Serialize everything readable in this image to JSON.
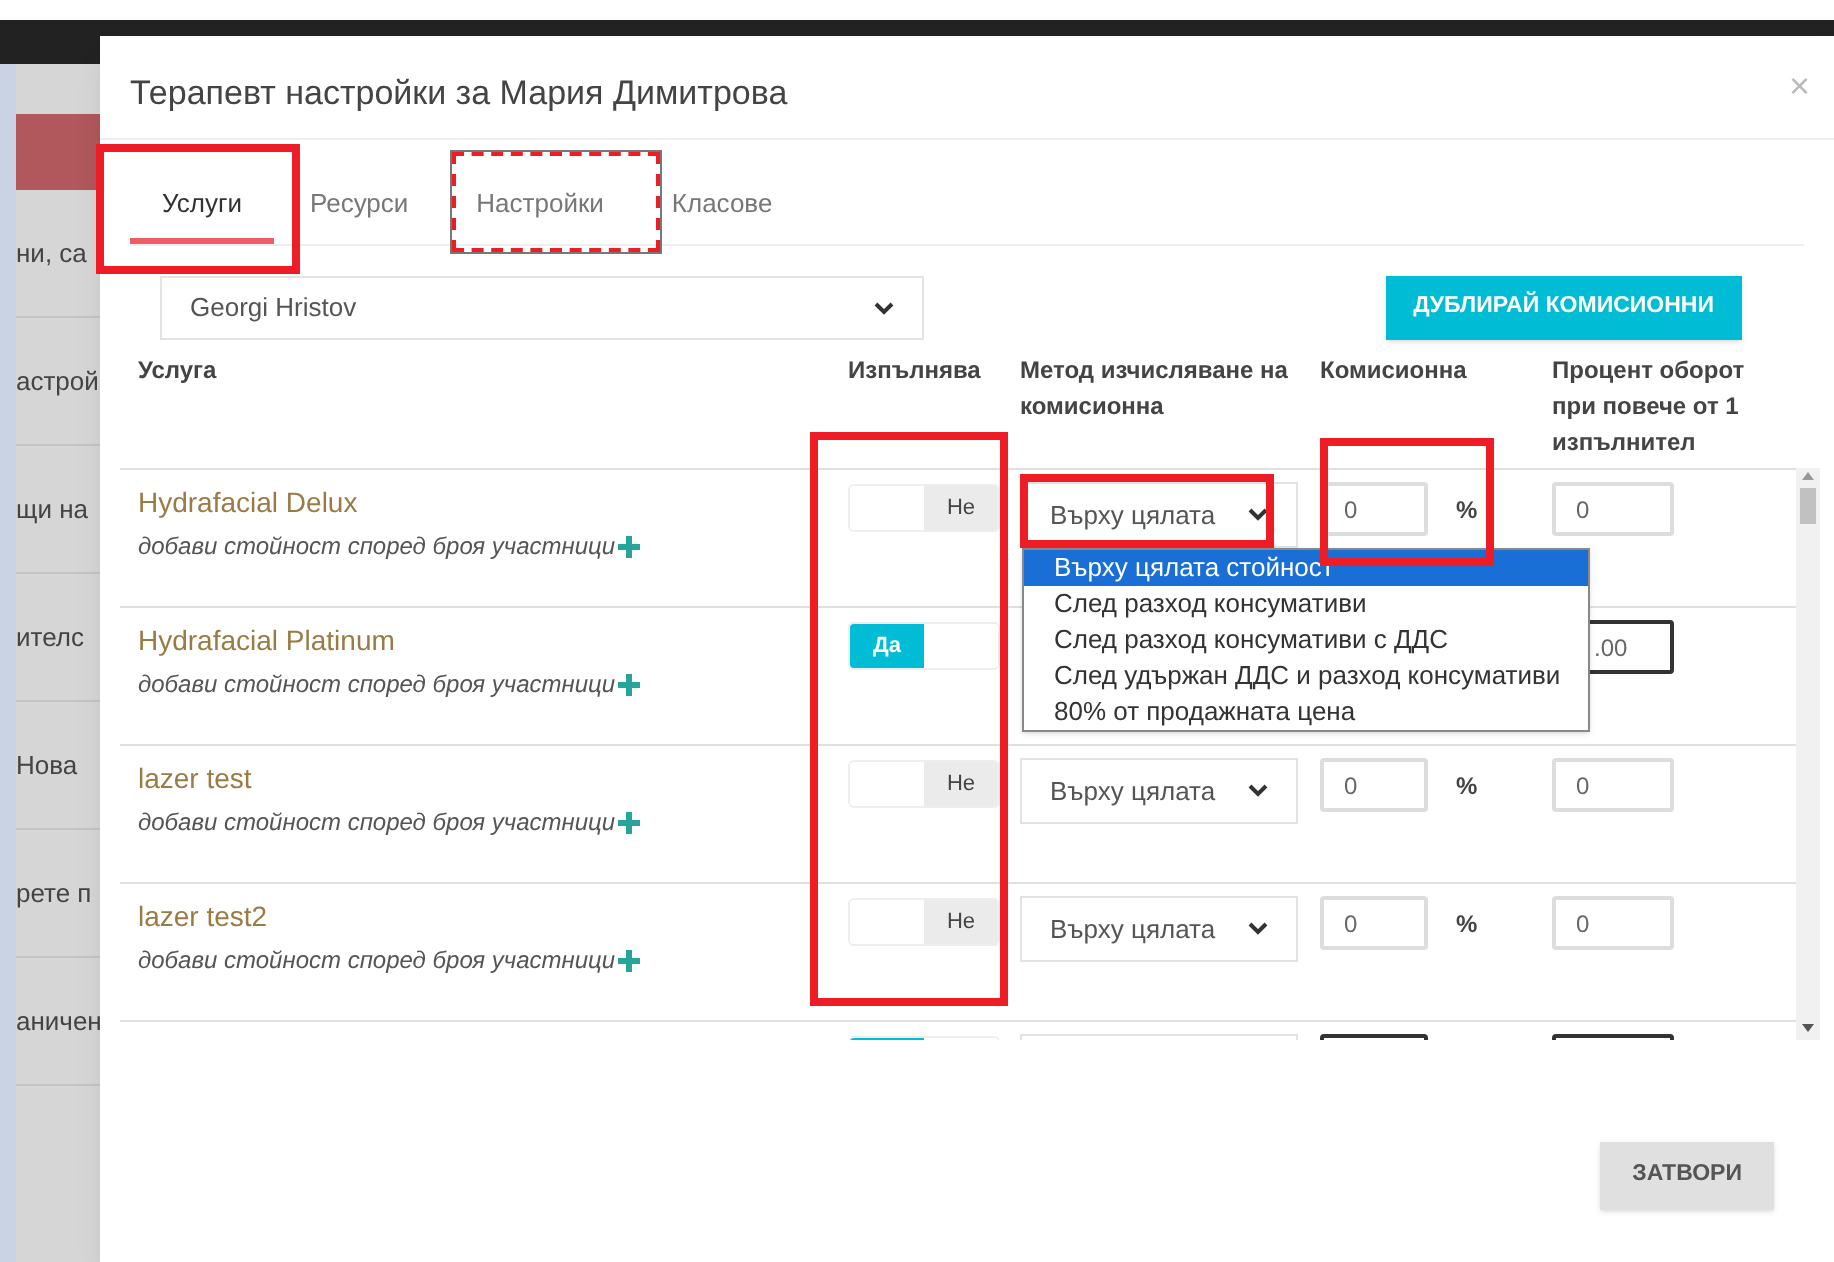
{
  "background_menu": [
    "ни, са",
    "астрой",
    "щи на",
    "ителс",
    "Нова",
    "рете п",
    "аничен"
  ],
  "dialog": {
    "title": "Терапевт настройки за Мария Димитрова",
    "close": "×",
    "tabs": [
      {
        "label": "Услуги",
        "selected": true
      },
      {
        "label": "Ресурси",
        "selected": false
      },
      {
        "label": "Настройки",
        "selected": false
      },
      {
        "label": "Класове",
        "selected": false
      }
    ],
    "staff_select": "Georgi Hristov",
    "duplicate_button": "ДУБЛИРАЙ КОМИСИОННИ",
    "columns": [
      "Услуга",
      "Изпълнява",
      "Метод изчисляване на комисионна",
      "Комисионна",
      "Процент оборот при повече от 1 изпълнител"
    ],
    "rows": [
      {
        "name": "Hydrafacial Delux",
        "subtitle": "добави стойност според броя участници",
        "performs": {
          "on": false,
          "label": "Не"
        },
        "method": "Върху цялата",
        "commission": "0",
        "unit": "%",
        "turnover": "0",
        "open_options": [
          {
            "label": "Върху цялата стойност",
            "selected": true
          },
          {
            "label": "След разход консумативи",
            "selected": false
          },
          {
            "label": "След разход консумативи с ДДС",
            "selected": false
          },
          {
            "label": "След удържан ДДС и разход консумативи",
            "selected": false
          },
          {
            "label": "80% от продажната цена",
            "selected": false
          }
        ]
      },
      {
        "name": "Hydrafacial Platinum",
        "subtitle": "добави стойност според броя участници",
        "performs": {
          "on": true,
          "label": "Да"
        },
        "turnover": ".00"
      },
      {
        "name": "lazer test",
        "subtitle": "добави стойност според броя участници",
        "performs": {
          "on": false,
          "label": "Не"
        },
        "method": "Върху цялата",
        "commission": "0",
        "unit": "%",
        "turnover": "0"
      },
      {
        "name": "lazer test2",
        "subtitle": "добави стойност според броя участници",
        "performs": {
          "on": false,
          "label": "Не"
        },
        "method": "Върху цялата",
        "commission": "0",
        "unit": "%",
        "turnover": "0"
      },
      {
        "performs": {
          "on": true
        }
      }
    ],
    "close_button": "ЗАТВОРИ"
  }
}
